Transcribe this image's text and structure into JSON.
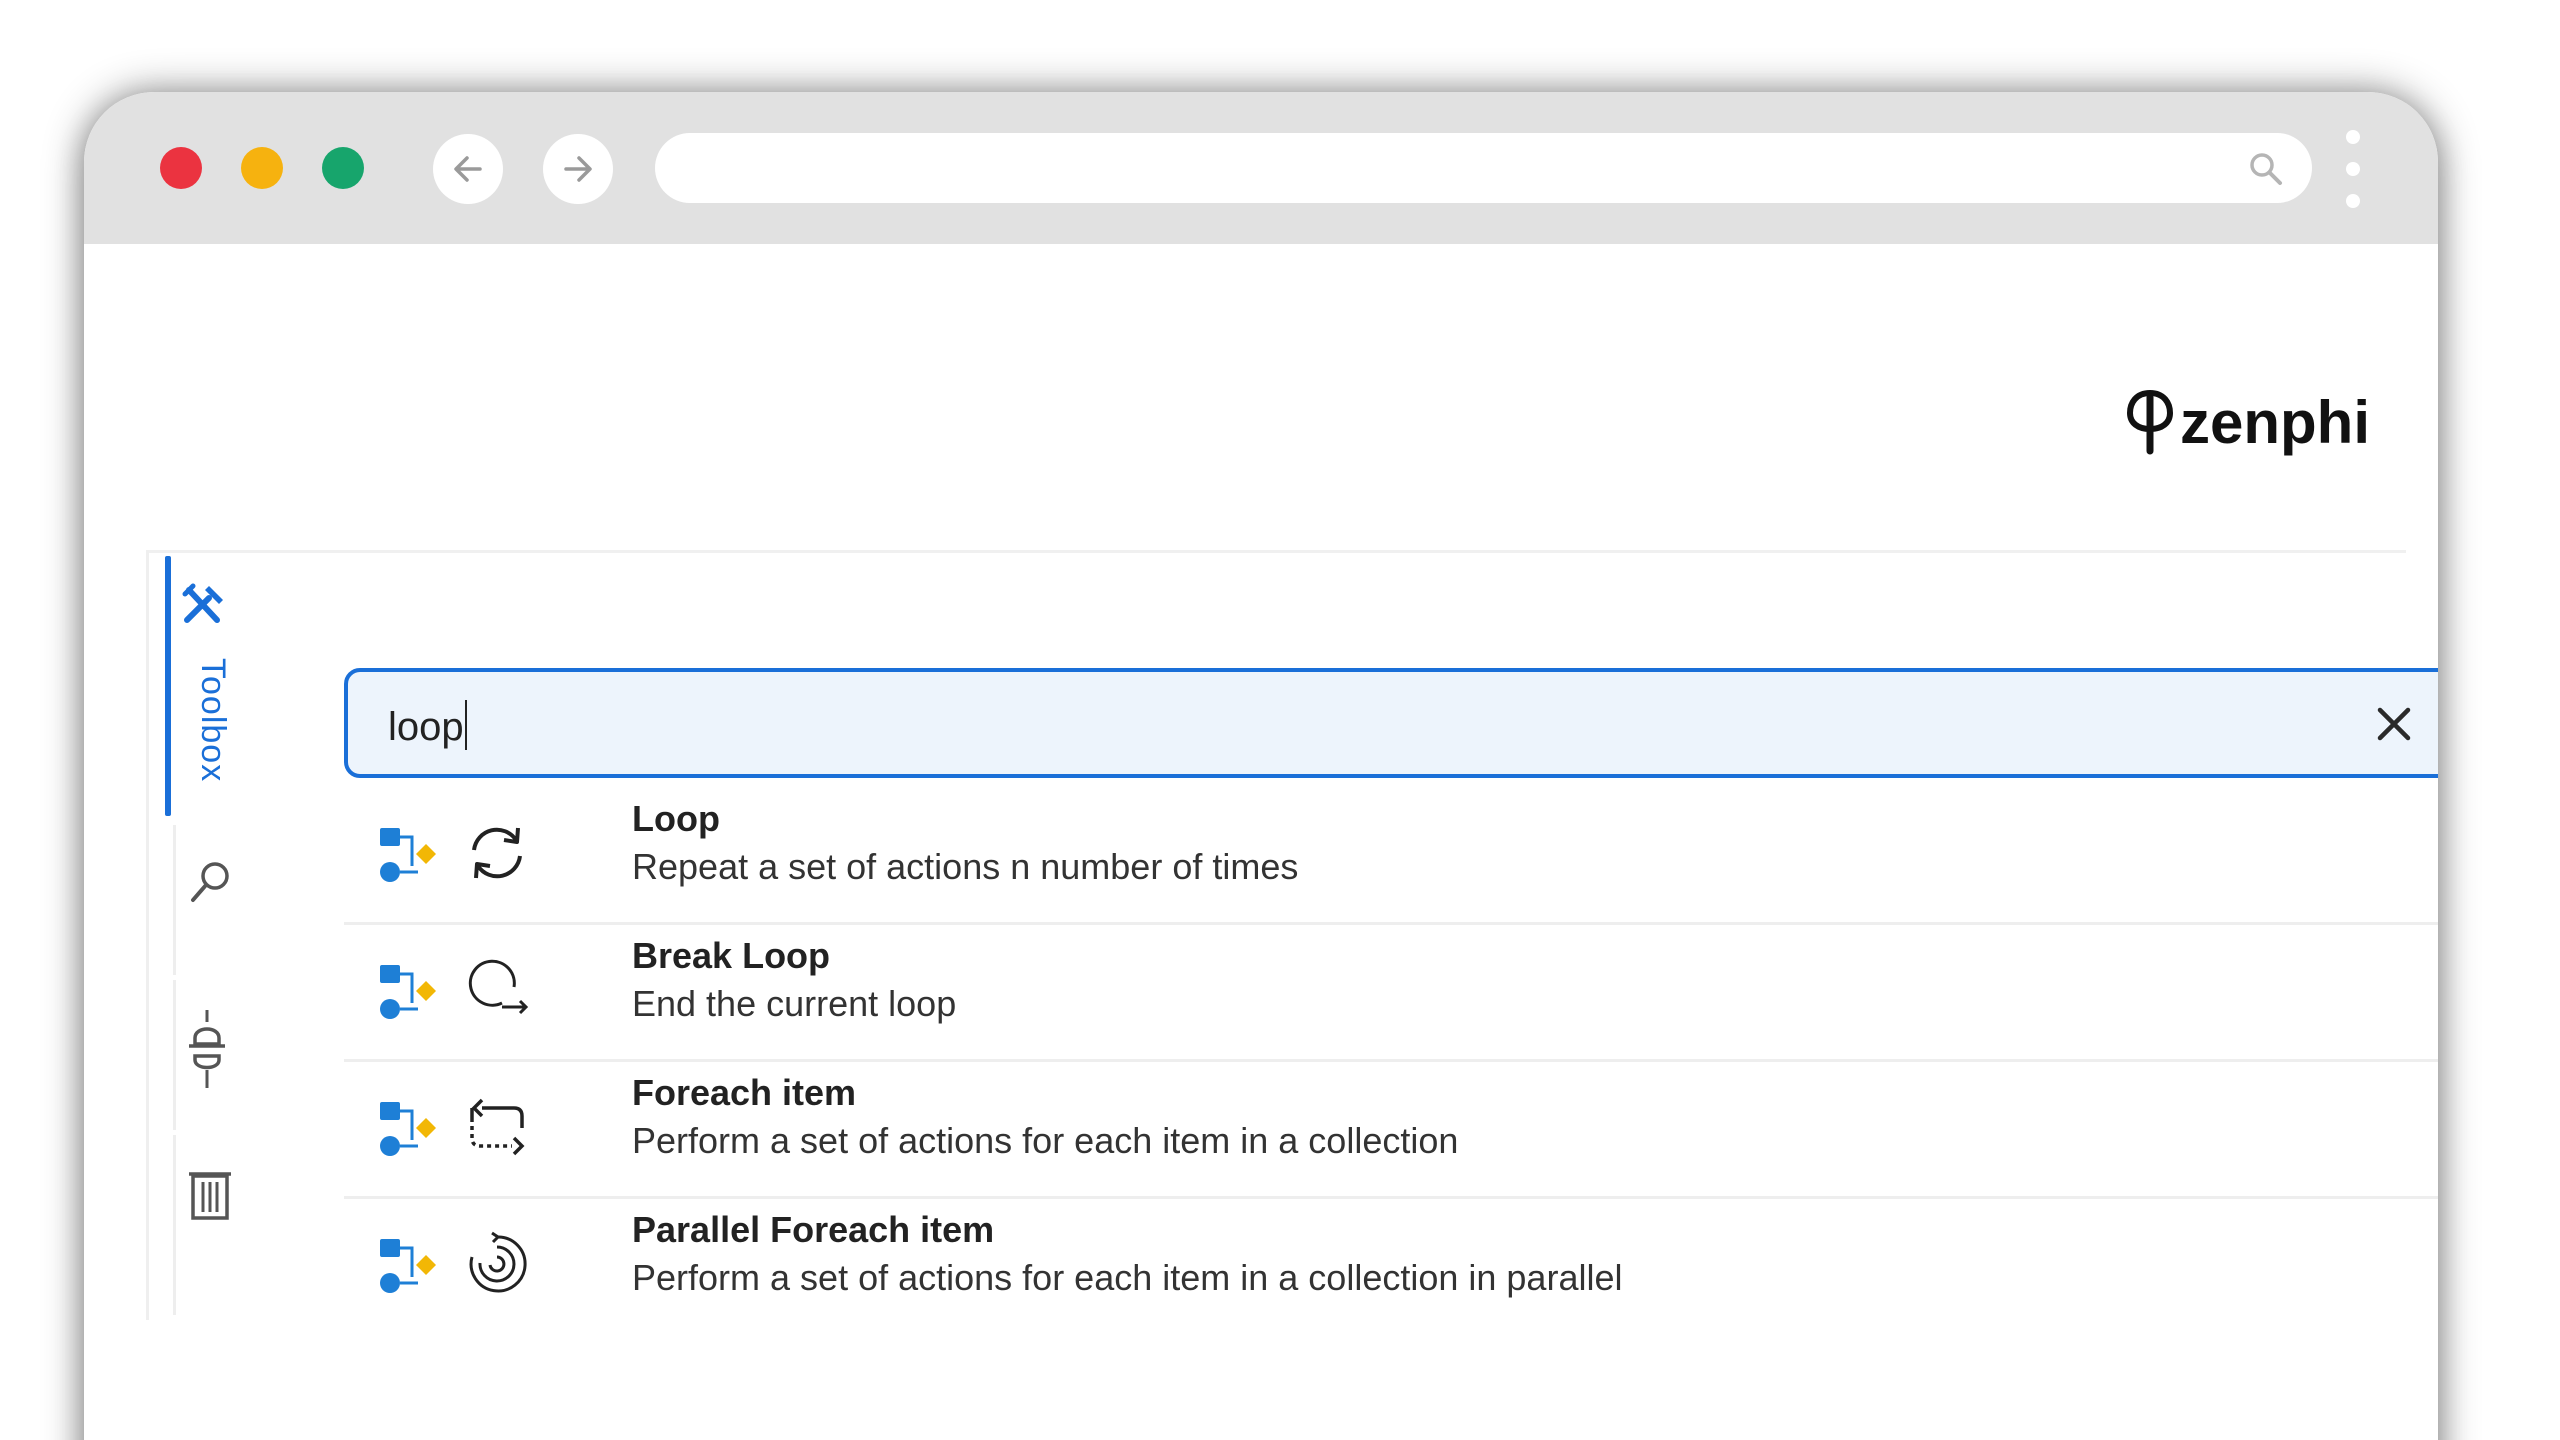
{
  "browser": {
    "url": "",
    "colors": {
      "close": "#eb3340",
      "minimize": "#f6b20f",
      "maximize": "#17a56c"
    }
  },
  "brand": {
    "logo_text": "zenphi"
  },
  "sidebar": {
    "tabs": [
      {
        "label": "Toolbox",
        "icon": "tools-icon",
        "active": true
      },
      {
        "label": "",
        "icon": "search-icon",
        "active": false
      },
      {
        "label": "",
        "icon": "plug-icon",
        "active": false
      },
      {
        "label": "",
        "icon": "bin-icon",
        "active": false
      }
    ]
  },
  "search": {
    "value": "loop"
  },
  "results": [
    {
      "title": "Loop",
      "description": "Repeat a set of actions n number of times",
      "icon": "loop-icon"
    },
    {
      "title": "Break Loop",
      "description": "End the current loop",
      "icon": "break-loop-icon"
    },
    {
      "title": "Foreach item",
      "description": "Perform a set of actions for each item in a collection",
      "icon": "foreach-icon"
    },
    {
      "title": "Parallel Foreach item",
      "description": "Perform a set of actions for each item in a collection in parallel",
      "icon": "parallel-foreach-icon"
    }
  ],
  "theme": {
    "accent": "#1a6fd8",
    "search_bg": "#edf4fc",
    "category_blue": "#1e7fd6",
    "category_yellow": "#f2b705"
  }
}
